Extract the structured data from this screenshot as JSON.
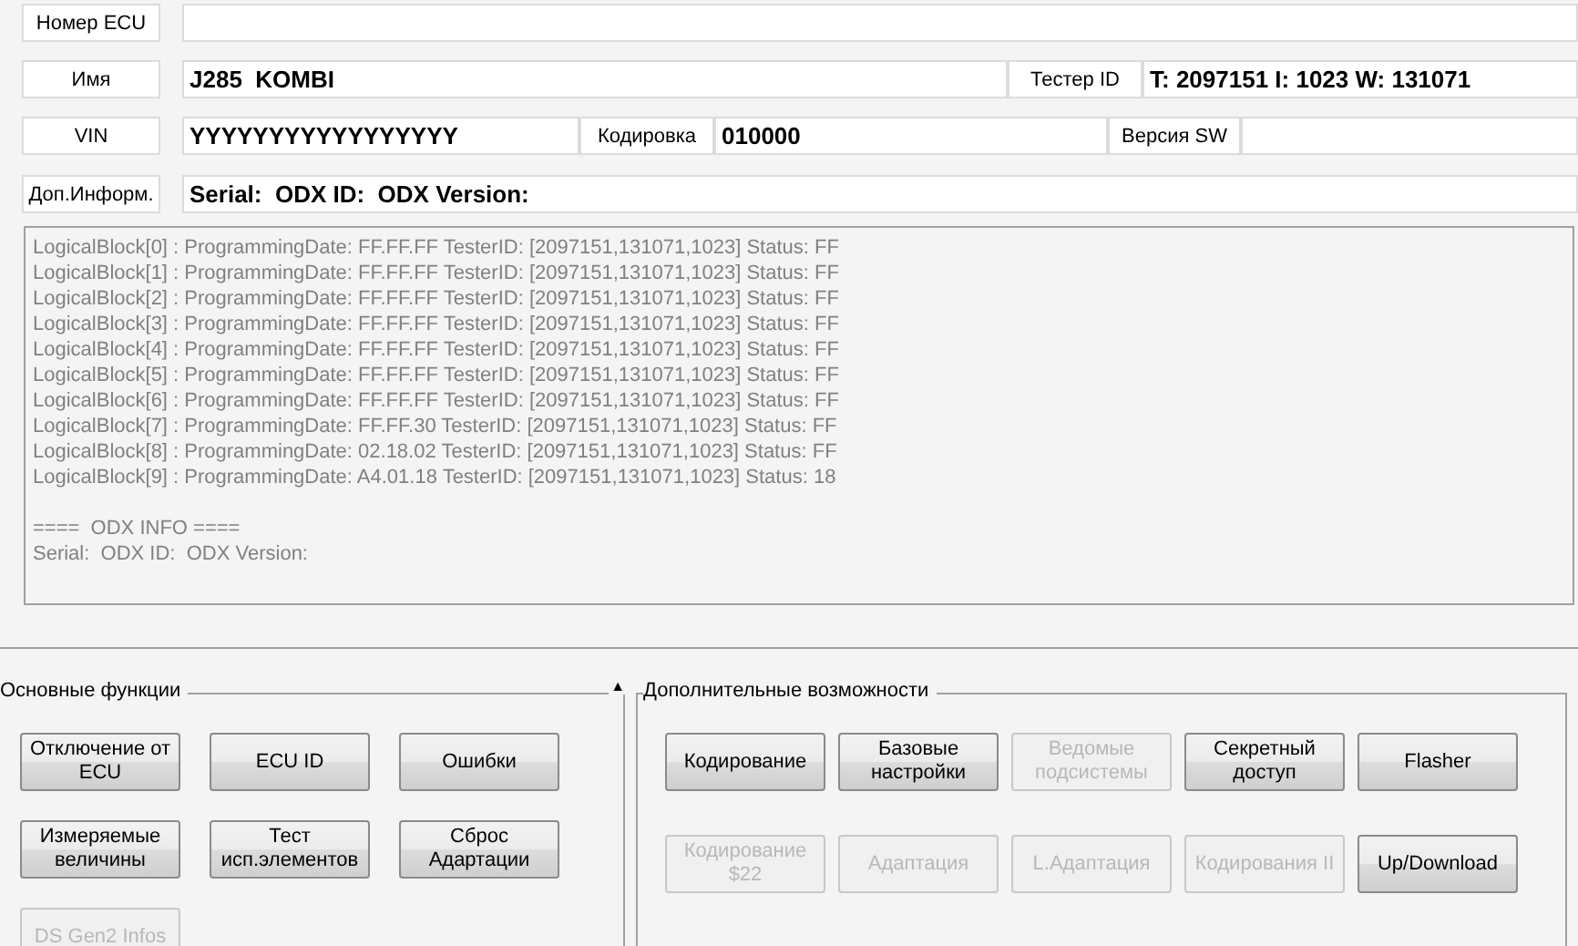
{
  "fields": {
    "ecu_number": {
      "label": "Номер ECU"
    },
    "name": {
      "label": "Имя",
      "value": "J285  KOMBI"
    },
    "tester_id": {
      "label": "Тестер ID",
      "value": "T: 2097151 I: 1023 W: 131071"
    },
    "vin": {
      "label": "VIN",
      "value": "YYYYYYYYYYYYYYYYY"
    },
    "coding": {
      "label": "Кодировка",
      "value": "010000"
    },
    "sw_version": {
      "label": "Версия SW"
    },
    "extra_info": {
      "label": "Доп.Информ.",
      "value": "Serial:  ODX ID:  ODX Version:"
    }
  },
  "log": {
    "blocks": [
      "LogicalBlock[0] : ProgrammingDate: FF.FF.FF TesterID: [2097151,131071,1023] Status: FF",
      "LogicalBlock[1] : ProgrammingDate: FF.FF.FF TesterID: [2097151,131071,1023] Status: FF",
      "LogicalBlock[2] : ProgrammingDate: FF.FF.FF TesterID: [2097151,131071,1023] Status: FF",
      "LogicalBlock[3] : ProgrammingDate: FF.FF.FF TesterID: [2097151,131071,1023] Status: FF",
      "LogicalBlock[4] : ProgrammingDate: FF.FF.FF TesterID: [2097151,131071,1023] Status: FF",
      "LogicalBlock[5] : ProgrammingDate: FF.FF.FF TesterID: [2097151,131071,1023] Status: FF",
      "LogicalBlock[6] : ProgrammingDate: FF.FF.FF TesterID: [2097151,131071,1023] Status: FF",
      "LogicalBlock[7] : ProgrammingDate: FF.FF.30 TesterID: [2097151,131071,1023] Status: FF",
      "LogicalBlock[8] : ProgrammingDate: 02.18.02 TesterID: [2097151,131071,1023] Status: FF",
      "LogicalBlock[9] : ProgrammingDate: A4.01.18 TesterID: [2097151,131071,1023] Status: 18"
    ],
    "odx_lines": [
      "====  ODX INFO ====",
      "Serial:  ODX ID:  ODX Version:"
    ]
  },
  "basic_functions": {
    "title": "Основные функции",
    "collapse_glyph": "▲",
    "buttons": [
      {
        "label": "Отключение от ECU",
        "disabled": false
      },
      {
        "label": "ECU ID",
        "disabled": false
      },
      {
        "label": "Ошибки",
        "disabled": false
      },
      {
        "label": "Измеряемые величины",
        "disabled": false
      },
      {
        "label": "Тест исп.элементов",
        "disabled": false
      },
      {
        "label": "Сброс Адартации",
        "disabled": false
      },
      {
        "label": "DS Gen2 Infos",
        "disabled": true
      }
    ]
  },
  "extra_functions": {
    "title": "Дополнительные возможности",
    "buttons": [
      {
        "label": "Кодирование",
        "disabled": false
      },
      {
        "label": "Базовые настройки",
        "disabled": false
      },
      {
        "label": "Ведомые подсистемы",
        "disabled": true
      },
      {
        "label": "Секретный доступ",
        "disabled": false
      },
      {
        "label": "Flasher",
        "disabled": false
      },
      {
        "label": "Кодирование $22",
        "disabled": true
      },
      {
        "label": "Адаптация",
        "disabled": true
      },
      {
        "label": "L.Адаптация",
        "disabled": true
      },
      {
        "label": "Кодирования II",
        "disabled": true
      },
      {
        "label": "Up/Download",
        "disabled": false
      }
    ]
  }
}
